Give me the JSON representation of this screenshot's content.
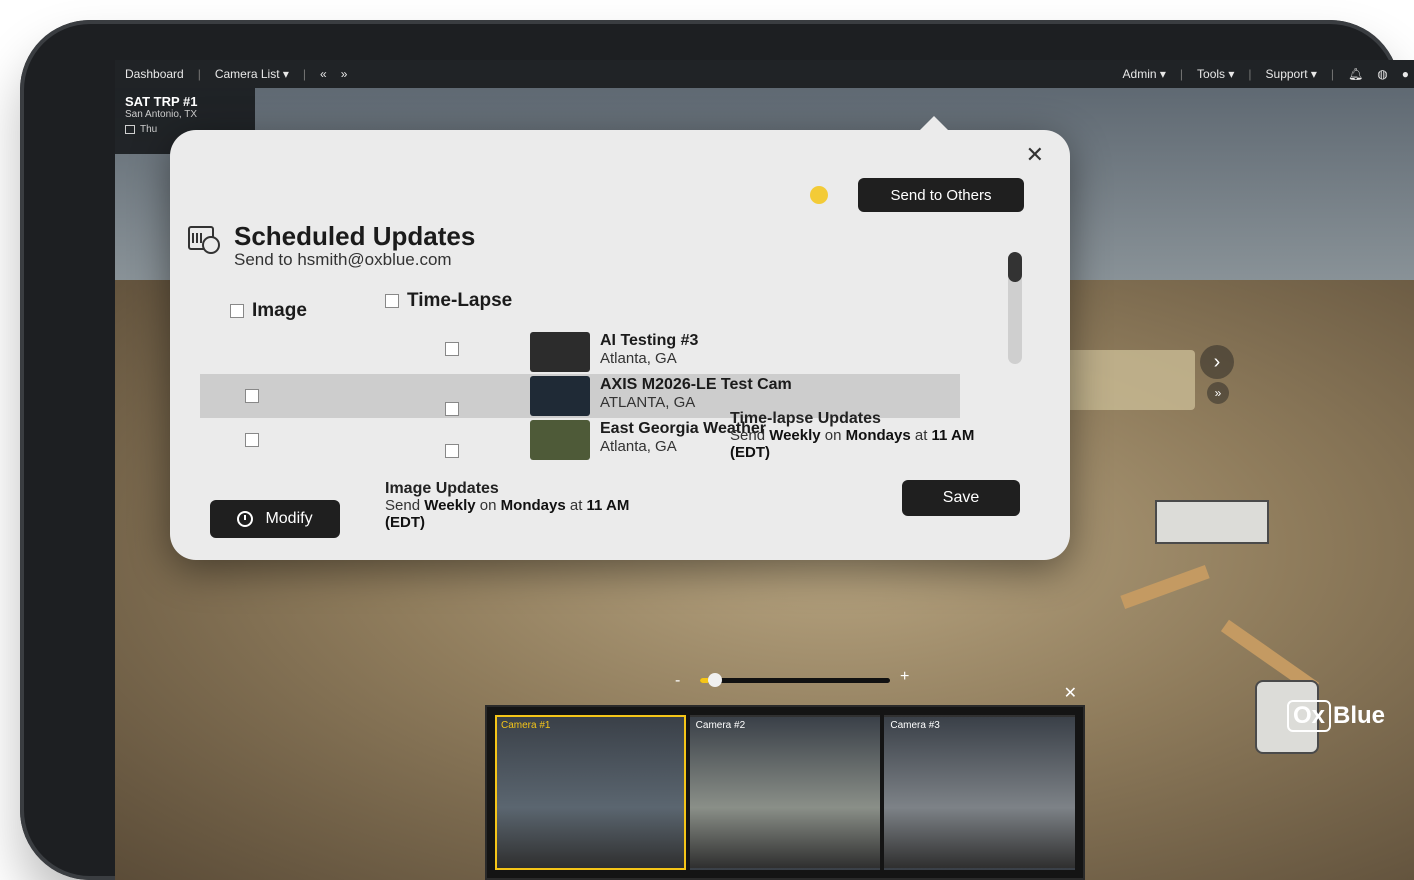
{
  "nav": {
    "dashboard": "Dashboard",
    "camera_list": "Camera List ▾",
    "prev": "«",
    "next": "»",
    "admin": "Admin ▾",
    "tools": "Tools ▾",
    "support": "Support ▾"
  },
  "site": {
    "title": "SAT TRP #1",
    "location": "San Antonio, TX",
    "date": "Thu"
  },
  "modal": {
    "close": "✕",
    "send_others": "Send to Others",
    "title": "Scheduled Updates",
    "subtitle": "Send to hsmith@oxblue.com",
    "col_image": "Image",
    "col_timelapse": "Time-Lapse",
    "cameras": [
      {
        "name": "AI Testing #3",
        "location": "Atlanta, GA",
        "thumb_color": "#2c2c2c"
      },
      {
        "name": "AXIS M2026-LE Test Cam",
        "location": "ATLANTA, GA",
        "thumb_color": "#1f2a36"
      },
      {
        "name": "East Georgia Weather",
        "location": "Atlanta, GA",
        "thumb_color": "#4e5a38"
      }
    ],
    "modify": "Modify",
    "image_updates": {
      "title": "Image Updates",
      "line_pre": "Send ",
      "freq": "Weekly",
      "on": " on ",
      "day": "Mondays",
      "at": " at ",
      "time": "11 AM",
      "tz": "(EDT)"
    },
    "timelapse_updates": {
      "title": "Time-lapse Updates",
      "line_pre": "Send ",
      "freq": "Weekly",
      "on": " on ",
      "day": "Mondays",
      "at": " at ",
      "time": "11 AM",
      "tz": "(EDT)"
    },
    "save": "Save"
  },
  "zoom": {
    "minus": "-",
    "plus": "+",
    "level": 0.05
  },
  "strip": {
    "close": "✕",
    "cameras": [
      {
        "label": "Camera #1",
        "active": true,
        "color": "#5b6670"
      },
      {
        "label": "Camera #2",
        "active": false,
        "color": "#8a8f88"
      },
      {
        "label": "Camera #3",
        "active": false,
        "color": "#7d8287"
      }
    ]
  },
  "brand": {
    "ox": "Ox",
    "blue": "Blue"
  },
  "colors": {
    "accent": "#f5c518",
    "dark_button": "#1f1f1f",
    "modal_bg": "#ebebeb"
  }
}
